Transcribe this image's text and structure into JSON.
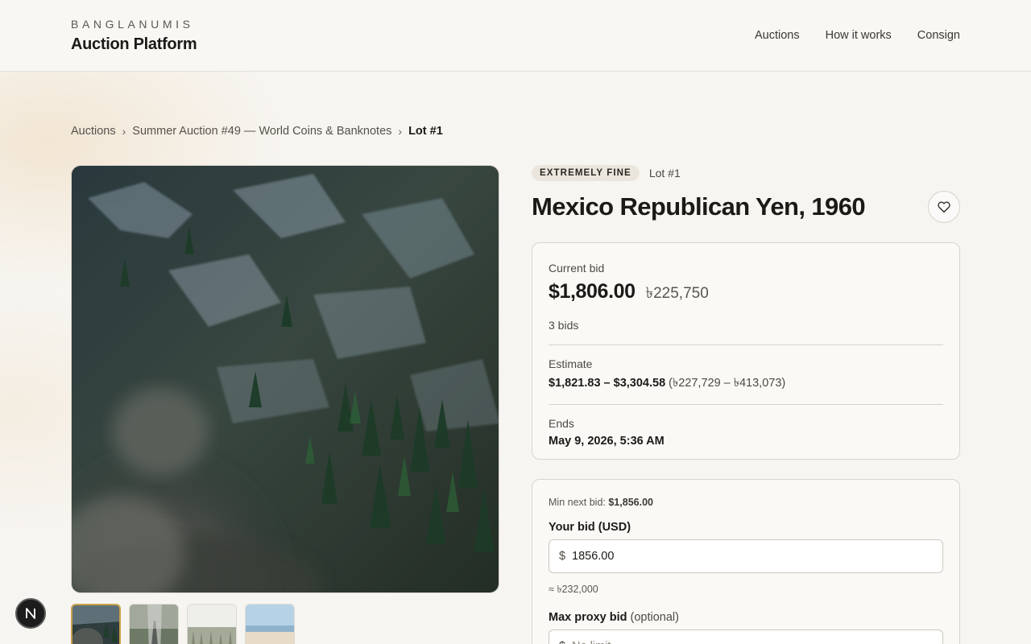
{
  "header": {
    "brand_kicker": "BANGLANUMIS",
    "brand_title": "Auction Platform",
    "nav": [
      "Auctions",
      "How it works",
      "Consign"
    ]
  },
  "breadcrumb": {
    "items": [
      "Auctions",
      "Summer Auction #49 — World Coins & Banknotes"
    ],
    "current": "Lot #1",
    "separator": "›"
  },
  "gallery": {
    "main_image": "forest-aerial-photo",
    "thumbnails": [
      "forest-aerial-thumb",
      "misty-road-thumb",
      "pine-forest-thumb",
      "beach-thumb"
    ],
    "active_index": 0
  },
  "lot": {
    "grade": "EXTREMELY FINE",
    "lot_label": "Lot #1",
    "title": "Mexico Republican Yen, 1960",
    "favorite_icon": "heart-icon"
  },
  "bid_summary": {
    "current_bid_label": "Current bid",
    "current_bid_usd": "$1,806.00",
    "current_bid_local": "৳225,750",
    "bids_count": "3 bids",
    "estimate_label": "Estimate",
    "estimate_usd": "$1,821.83 – $3,304.58",
    "estimate_local": "(৳227,729 – ৳413,073)",
    "ends_label": "Ends",
    "ends_value": "May 9, 2026, 5:36 AM"
  },
  "place_bid": {
    "min_next_label": "Min next bid:",
    "min_next_value": "$1,856.00",
    "your_bid_label": "Your bid (USD)",
    "currency_symbol": "$",
    "your_bid_value": "1856.00",
    "approx_local": "≈ ৳232,000",
    "max_proxy_label": "Max proxy bid",
    "max_proxy_optional": "(optional)",
    "max_proxy_placeholder": "No limit"
  },
  "help_fab": {
    "letter": "N"
  },
  "colors": {
    "page_bg": "#f7f5f1",
    "text": "#1c1a17",
    "accent_gold": "#c8a24b",
    "badge_bg": "#ebe6dd"
  }
}
